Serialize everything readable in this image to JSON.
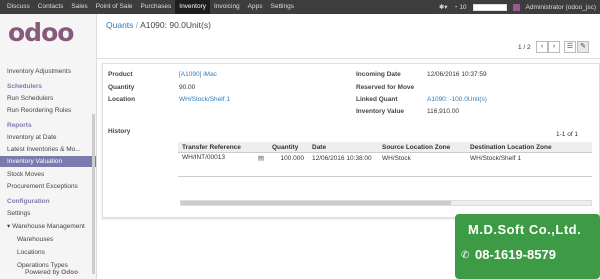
{
  "topbar": {
    "menu": [
      "Discuss",
      "Contacts",
      "Sales",
      "Point of Sale",
      "Purchases",
      "Inventory",
      "Invoicing",
      "Apps",
      "Settings"
    ],
    "active": "Inventory",
    "notifications": "10",
    "user": "Administrator (odoo_jsc)"
  },
  "logo": "odoo",
  "sidebar": {
    "items": [
      {
        "label": "Inventory Adjustments",
        "type": "item"
      },
      {
        "label": "Schedulers",
        "type": "head"
      },
      {
        "label": "Run Schedulers",
        "type": "item"
      },
      {
        "label": "Run Reordering Rules",
        "type": "item"
      },
      {
        "label": "Reports",
        "type": "head"
      },
      {
        "label": "Inventory at Date",
        "type": "item"
      },
      {
        "label": "Latest Inventories & Mo...",
        "type": "item"
      },
      {
        "label": "Inventory Valuation",
        "type": "active"
      },
      {
        "label": "Stock Moves",
        "type": "item"
      },
      {
        "label": "Procurement Exceptions",
        "type": "item"
      },
      {
        "label": "Configuration",
        "type": "head"
      },
      {
        "label": "Settings",
        "type": "item"
      },
      {
        "label": "Warehouse Management",
        "type": "item"
      },
      {
        "label": "Warehouses",
        "type": "sub"
      },
      {
        "label": "Locations",
        "type": "sub"
      },
      {
        "label": "Operations Types",
        "type": "sub"
      }
    ],
    "powered_prefix": "Powered by",
    "powered_brand": "Odoo"
  },
  "breadcrumb": {
    "parent": "Quants",
    "sep": "/",
    "current": "A1090: 90.0Unit(s)"
  },
  "pager": {
    "text": "1 / 2",
    "prev": "‹",
    "next": "›"
  },
  "form": {
    "product_label": "Product",
    "product": "[A1090] iMac",
    "quantity_label": "Quantity",
    "quantity": "90.00",
    "location_label": "Location",
    "location": "WH/Stock/Shelf 1",
    "incoming_label": "Incoming Date",
    "incoming": "12/06/2016 10:37:59",
    "reserved_label": "Reserved for Move",
    "reserved": "",
    "linked_label": "Linked Quant",
    "linked": "A1090: -100.0Unit(s)",
    "value_label": "Inventory Value",
    "value": "116,910.00",
    "history_label": "History",
    "history_pager": "1-1 of 1"
  },
  "history": {
    "headers": [
      "Transfer Reference",
      "Quantity",
      "Date",
      "Source Location Zone",
      "Destination Location Zone"
    ],
    "rows": [
      [
        "WH/INT/00013",
        "100.000",
        "12/06/2016 10:38:00",
        "WH/Stock",
        "WH/Stock/Shelf 1"
      ]
    ]
  },
  "promo": {
    "name": "M.D.Soft Co.,Ltd.",
    "phone": "08-1619-8579"
  },
  "colors": {
    "topbar": "#3d3d3d",
    "accent": "#7c7bad",
    "brand": "#875a7b",
    "link": "#337ab7",
    "promo": "#3e9b45"
  }
}
